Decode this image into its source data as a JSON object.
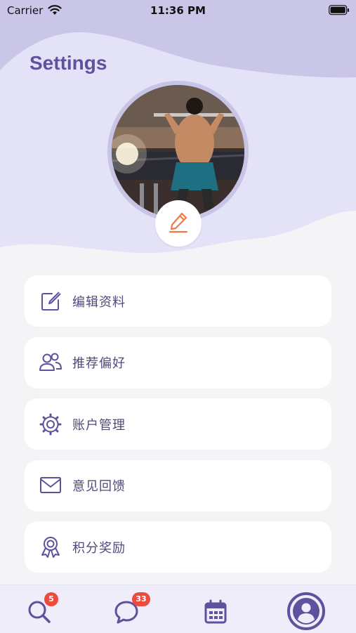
{
  "status_bar": {
    "carrier": "Carrier",
    "time": "11:36 PM"
  },
  "header": {
    "title": "Settings"
  },
  "colors": {
    "accent": "#5e519e",
    "header_bg": "#e4e2f7",
    "wave_top": "#cac6e8",
    "edit_orange": "#ee7a45",
    "badge": "#ee4b3f"
  },
  "menu": {
    "items": [
      {
        "label": "编辑资料",
        "icon": "edit-profile-icon"
      },
      {
        "label": "推荐偏好",
        "icon": "users-icon"
      },
      {
        "label": "账户管理",
        "icon": "settings-gear-icon"
      },
      {
        "label": "意见回馈",
        "icon": "mail-icon"
      },
      {
        "label": "积分奖励",
        "icon": "award-ribbon-icon"
      }
    ]
  },
  "tab_bar": {
    "tabs": [
      {
        "name": "search",
        "icon": "search-icon",
        "badge": "5"
      },
      {
        "name": "messages",
        "icon": "chat-bubble-icon",
        "badge": "33"
      },
      {
        "name": "calendar",
        "icon": "calendar-icon",
        "badge": ""
      },
      {
        "name": "profile",
        "icon": "profile-icon",
        "badge": "",
        "active": true
      }
    ]
  }
}
